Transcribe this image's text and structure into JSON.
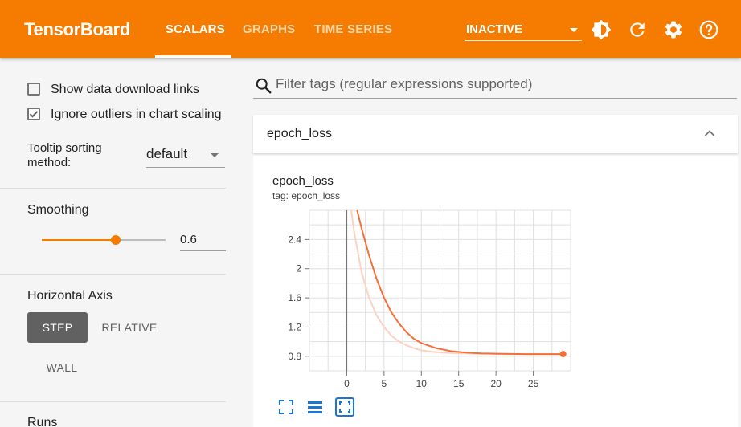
{
  "header": {
    "brand": "TensorBoard",
    "tabs": [
      {
        "label": "SCALARS",
        "active": true
      },
      {
        "label": "GRAPHS",
        "active": false
      },
      {
        "label": "TIME SERIES",
        "active": false
      }
    ],
    "run_state": "INACTIVE",
    "icons": [
      "brightness-icon",
      "refresh-icon",
      "settings-icon",
      "help-icon"
    ]
  },
  "sidebar": {
    "show_download_links": {
      "label": "Show data download links",
      "checked": false
    },
    "ignore_outliers": {
      "label": "Ignore outliers in chart scaling",
      "checked": true
    },
    "tooltip_sorting": {
      "label": "Tooltip sorting method:",
      "value": "default"
    },
    "smoothing": {
      "label": "Smoothing",
      "value": "0.6",
      "level": 0.6
    },
    "horizontal_axis": {
      "label": "Horizontal Axis",
      "options": [
        "STEP",
        "RELATIVE",
        "WALL"
      ],
      "selected": "STEP"
    },
    "runs_label": "Runs"
  },
  "main": {
    "filter": {
      "placeholder": "Filter tags (regular expressions supported)"
    },
    "group": {
      "title": "epoch_loss"
    },
    "card": {
      "title": "epoch_loss",
      "subtitle": "tag: epoch_loss"
    }
  },
  "colors": {
    "accent": "#f57c00",
    "line": "#f4703a",
    "line_raw": "#fcd2c2"
  },
  "chart_data": {
    "type": "line",
    "title": "epoch_loss",
    "xlabel": "",
    "ylabel": "",
    "x_ticks": [
      0,
      5,
      10,
      15,
      20,
      25
    ],
    "y_ticks": [
      0.8,
      1.2,
      1.6,
      2,
      2.4
    ],
    "xlim": [
      -5,
      30
    ],
    "ylim": [
      0.6,
      2.8
    ],
    "grid": true,
    "series": [
      {
        "role": "smoothed",
        "x": [
          1.4,
          2,
          3,
          4,
          5,
          6,
          7,
          8,
          9,
          10,
          12,
          14,
          16,
          18,
          20,
          22,
          24,
          26,
          28,
          29
        ],
        "y": [
          2.8,
          2.55,
          2.18,
          1.86,
          1.6,
          1.4,
          1.25,
          1.13,
          1.04,
          0.98,
          0.91,
          0.87,
          0.85,
          0.84,
          0.835,
          0.832,
          0.83,
          0.83,
          0.83,
          0.83
        ]
      },
      {
        "role": "raw",
        "x": [
          0.6,
          1,
          2,
          3,
          4,
          5,
          6,
          7,
          8,
          9,
          10,
          12,
          14,
          16,
          18,
          20,
          22,
          24,
          26,
          28,
          29
        ],
        "y": [
          2.8,
          2.5,
          1.95,
          1.6,
          1.36,
          1.2,
          1.08,
          1.0,
          0.95,
          0.91,
          0.88,
          0.855,
          0.845,
          0.84,
          0.835,
          0.832,
          0.83,
          0.83,
          0.83,
          0.83,
          0.83
        ]
      }
    ]
  }
}
